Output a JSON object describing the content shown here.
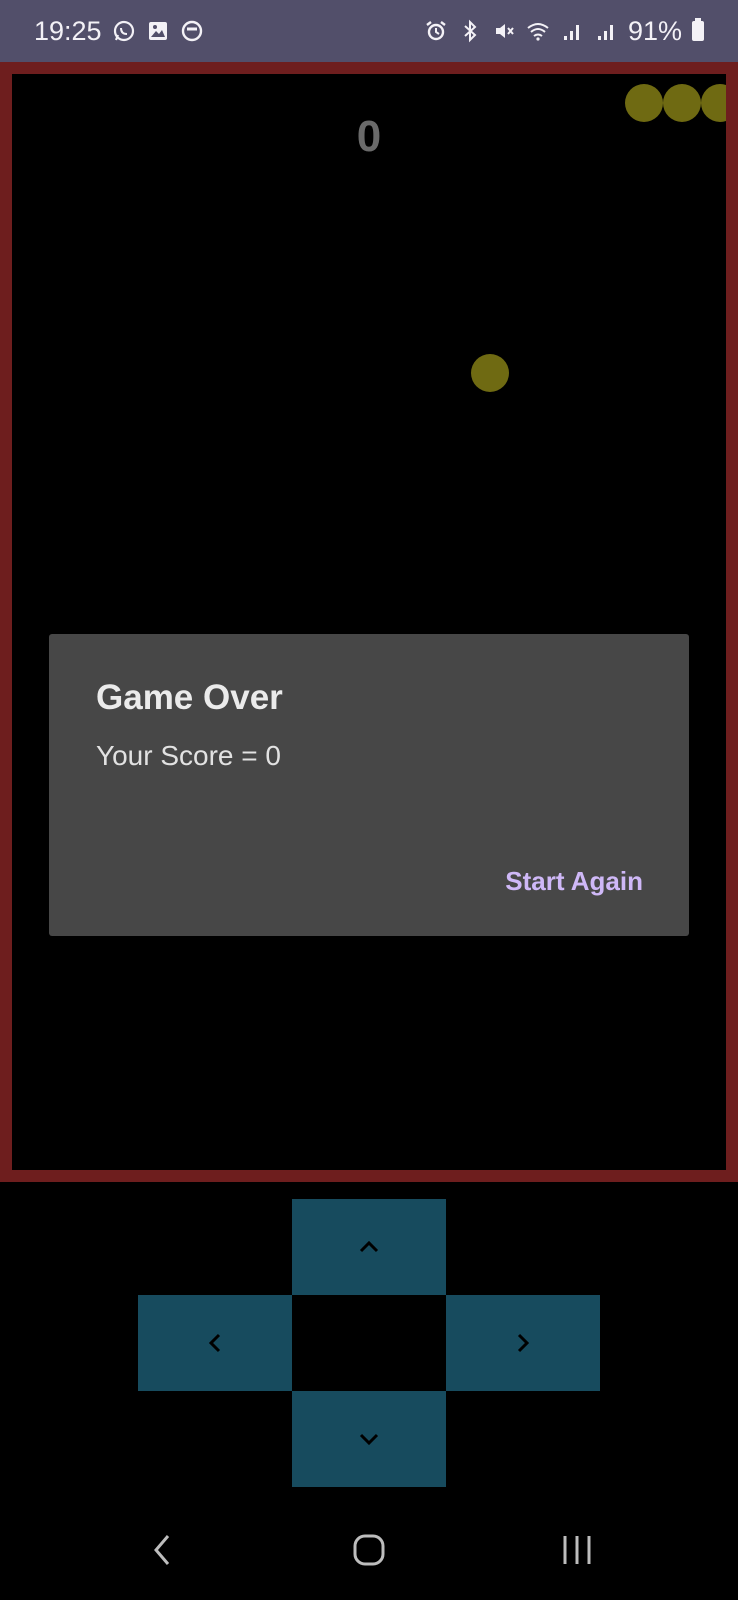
{
  "status_bar": {
    "time": "19:25",
    "battery_text": "91%",
    "left_icons": [
      "whatsapp-icon",
      "gallery-icon",
      "app-notification-icon"
    ],
    "right_icons": [
      "alarm-icon",
      "bluetooth-icon",
      "mute-icon",
      "wifi-icon",
      "signal-icon",
      "signal-icon",
      "battery-icon"
    ]
  },
  "game": {
    "score": "0",
    "colors": {
      "border": "#6e1e1e",
      "snake": "#6f6a12",
      "food": "#6f6a12",
      "background": "#000000"
    }
  },
  "dialog": {
    "title": "Game Over",
    "message": "Your Score = 0",
    "button_label": "Start Again"
  },
  "controls": {
    "buttons": [
      "up",
      "left",
      "right",
      "down"
    ],
    "icons": [
      "chevron-up-icon",
      "chevron-left-icon",
      "chevron-right-icon",
      "chevron-down-icon"
    ],
    "color": "#174b5e"
  },
  "navigation": {
    "buttons": [
      "back-icon",
      "home-icon",
      "recents-icon"
    ]
  }
}
